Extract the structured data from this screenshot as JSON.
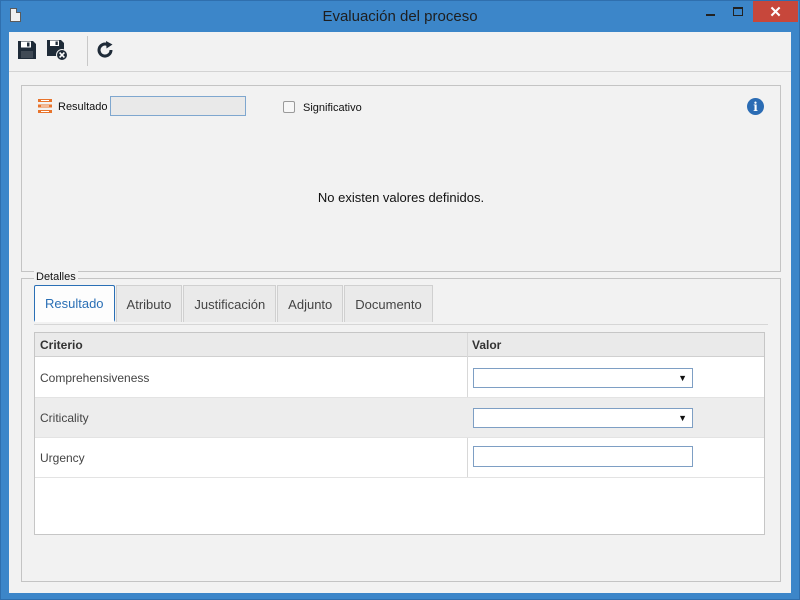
{
  "window": {
    "title": "Evaluación del proceso"
  },
  "toolbar": {
    "save_icon": "save-icon",
    "save_close_icon": "save-and-close-icon",
    "refresh_icon": "refresh-icon"
  },
  "result": {
    "label": "Resultado",
    "value": "",
    "significant_label": "Significativo",
    "significant_checked": false,
    "empty_message": "No existen valores definidos."
  },
  "details": {
    "legend": "Detalles",
    "tabs": [
      {
        "label": "Resultado",
        "active": true
      },
      {
        "label": "Atributo",
        "active": false
      },
      {
        "label": "Justificación",
        "active": false
      },
      {
        "label": "Adjunto",
        "active": false
      },
      {
        "label": "Documento",
        "active": false
      }
    ],
    "grid": {
      "columns": [
        "Criterio",
        "Valor"
      ],
      "rows": [
        {
          "criterion": "Comprehensiveness",
          "value": "",
          "input_type": "select"
        },
        {
          "criterion": "Criticality",
          "value": "",
          "input_type": "select"
        },
        {
          "criterion": "Urgency",
          "value": "",
          "input_type": "text"
        }
      ]
    }
  },
  "colors": {
    "accent": "#2a6fb5",
    "titlebar": "#3c86c9",
    "close_button": "#c7473b"
  }
}
